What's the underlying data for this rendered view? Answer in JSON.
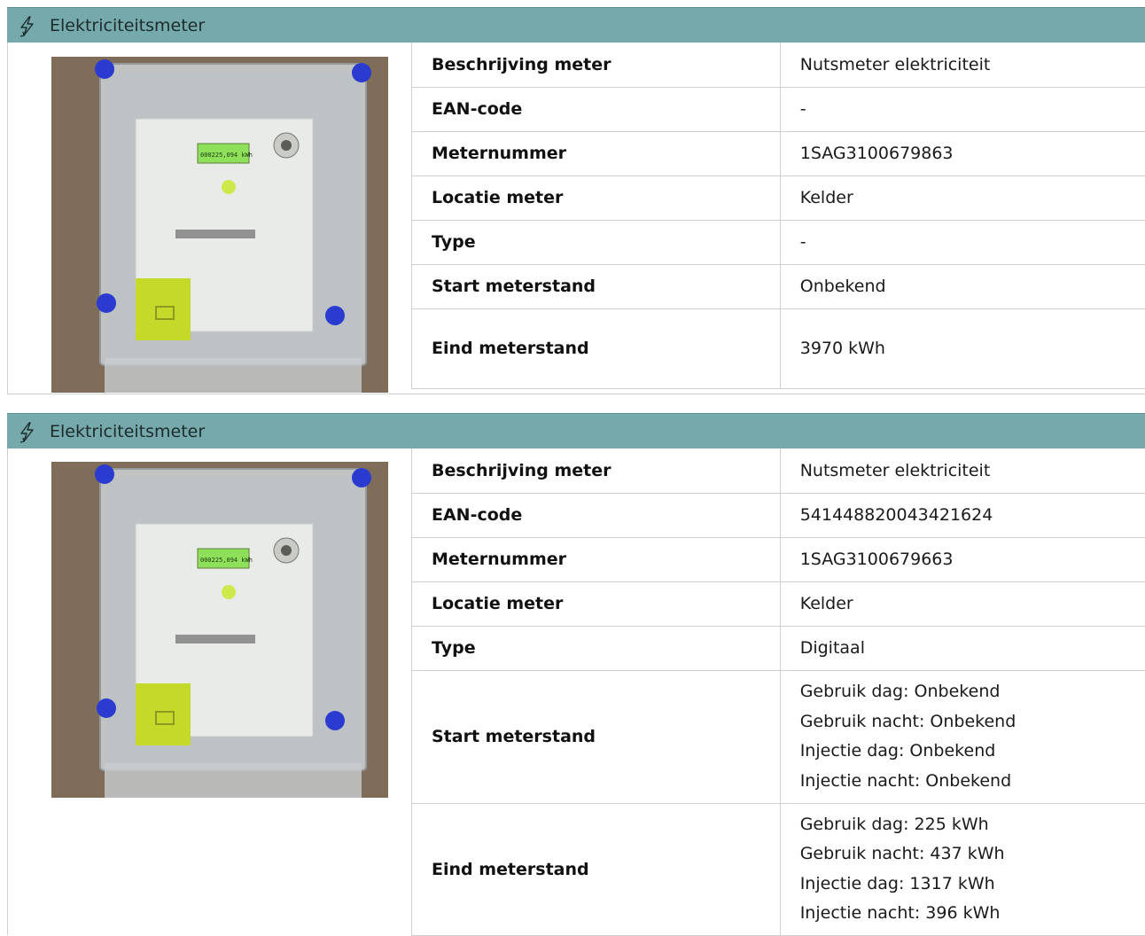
{
  "meters": [
    {
      "header_title": "Elektriciteitsmeter",
      "icon": "lightning-bolt-icon",
      "rows": [
        {
          "label": "Beschrijving meter",
          "value": [
            "Nutsmeter elektriciteit"
          ]
        },
        {
          "label": "EAN-code",
          "value": [
            "-"
          ]
        },
        {
          "label": "Meternummer",
          "value": [
            "1SAG3100679863"
          ]
        },
        {
          "label": "Locatie meter",
          "value": [
            "Kelder"
          ]
        },
        {
          "label": "Type",
          "value": [
            "-"
          ]
        },
        {
          "label": "Start meterstand",
          "value": [
            "Onbekend"
          ]
        },
        {
          "label": "Eind meterstand",
          "value": [
            "3970 kWh"
          ]
        }
      ]
    },
    {
      "header_title": "Elektriciteitsmeter",
      "icon": "lightning-bolt-icon",
      "rows": [
        {
          "label": "Beschrijving meter",
          "value": [
            "Nutsmeter elektriciteit"
          ]
        },
        {
          "label": "EAN-code",
          "value": [
            "541448820043421624"
          ]
        },
        {
          "label": "Meternummer",
          "value": [
            "1SAG3100679663"
          ]
        },
        {
          "label": "Locatie meter",
          "value": [
            "Kelder"
          ]
        },
        {
          "label": "Type",
          "value": [
            "Digitaal"
          ]
        },
        {
          "label": "Start meterstand",
          "value": [
            "Gebruik dag: Onbekend",
            "Gebruik nacht: Onbekend",
            "Injectie dag: Onbekend",
            "Injectie nacht: Onbekend"
          ]
        },
        {
          "label": "Eind meterstand",
          "value": [
            "Gebruik dag: 225 kWh",
            "Gebruik nacht: 437 kWh",
            "Injectie dag: 1317 kWh",
            "Injectie nacht: 396 kWh"
          ]
        }
      ]
    }
  ],
  "photo_display_reading": "000225,094 kWh",
  "colors": {
    "header_bg": "#75a9ab",
    "border": "#cfcfcf",
    "meter_cover": "#c5d92b",
    "display": "#8ee05a"
  }
}
